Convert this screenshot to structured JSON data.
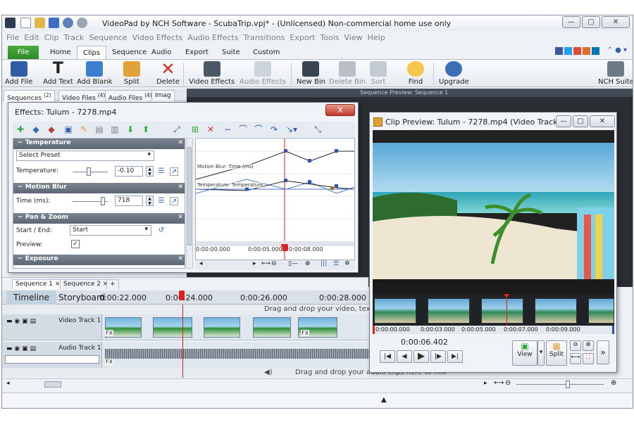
{
  "window": {
    "title": "VideoPad by NCH Software - ScubaTrip.vpj* - (Unlicensed) Non-commercial home use only",
    "min": "—",
    "max": "▢",
    "close": "✕"
  },
  "menu": [
    "File",
    "Edit",
    "Clip",
    "Track",
    "Sequence",
    "Video Effects",
    "Audio Effects",
    "Transitions",
    "Export",
    "Tools",
    "View",
    "Help"
  ],
  "ribbon_tabs": [
    "File",
    "Home",
    "Clips",
    "Sequence",
    "Audio",
    "Export",
    "Suite",
    "Custom"
  ],
  "ribbon_buttons": {
    "add_file": "Add File",
    "add_text": "Add Text",
    "add_blank": "Add Blank",
    "split": "Split",
    "delete": "Delete",
    "video_effects": "Video Effects",
    "audio_effects": "Audio Effects",
    "new_bin": "New Bin",
    "delete_bin": "Delete Bin",
    "sort": "Sort",
    "find": "Find",
    "upgrade": "Upgrade",
    "nch_suite": "NCH Suite"
  },
  "panel_tabs": {
    "sequences": "Sequences",
    "sequences_count": "(2)",
    "video_files": "Video Files",
    "video_files_count": "(4)",
    "audio_files": "Audio Files",
    "audio_files_count": "(4)",
    "images": "Imag"
  },
  "sequence_preview_title": "Sequence Preview: Sequence 1",
  "sequence_tabs": {
    "seq1": "Sequence 1",
    "seq2": "Sequence 2",
    "add": "+"
  },
  "timeline": {
    "tab_timeline": "Timeline",
    "tab_storyboard": "Storyboard",
    "ruler": [
      "0:00:22.000",
      "0:00:24.000",
      "0:00:26.000",
      "0:00:28.000"
    ],
    "video_hint": "Drag and drop your video, text an",
    "video_track": "Video Track 1",
    "audio_track": "Audio Track 1",
    "audio_hint": "Drag and drop your audio clips here to mix",
    "fx": "FX"
  },
  "effects": {
    "title": "Effects: Tulum - 7278.mp4",
    "close": "X",
    "temperature": {
      "header": "Temperature",
      "preset": "Select Preset",
      "label": "Temperature:",
      "value": "-0.10"
    },
    "motion_blur": {
      "header": "Motion Blur",
      "label": "Time (ms):",
      "value": "718"
    },
    "pan_zoom": {
      "header": "Pan & Zoom",
      "start_end_label": "Start / End:",
      "start_end_value": "Start",
      "preview_label": "Preview:",
      "preview_check": "✓"
    },
    "exposure": {
      "header": "Exposure"
    },
    "graph": {
      "label_motion": "Motion Blur: Time (ms)",
      "label_temp": "Temperature: Temperature",
      "times": [
        "0:00:00.000",
        "0:00:05.000",
        "0:00:08.000"
      ]
    }
  },
  "clip_preview": {
    "title": "Clip Preview: Tulum - 7278.mp4 (Video Track 1)",
    "time_marks": [
      "0:00:00.000",
      "0:00:03.000",
      "0:00:05.000",
      "0:00:07.000",
      "0:00:09.000"
    ],
    "current_time": "0:00:06.402",
    "view": "View",
    "split": "Split",
    "more": "»"
  },
  "colors": {
    "accent_green": "#2f8a26",
    "playhead_red": "#e02020",
    "close_red": "#c2392a"
  }
}
